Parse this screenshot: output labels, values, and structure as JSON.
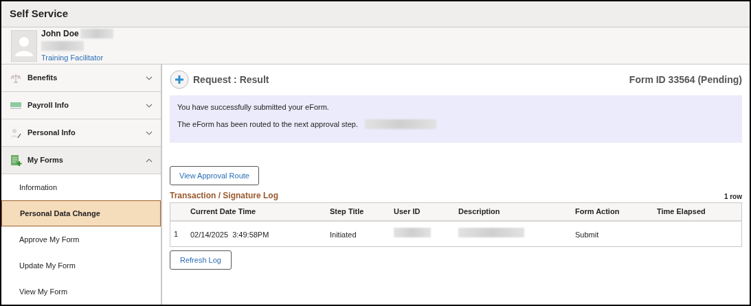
{
  "header": {
    "title": "Self Service"
  },
  "profile": {
    "name": "John Doe",
    "role": "Training Facilitator"
  },
  "sidebar": {
    "sections": [
      {
        "label": "Benefits",
        "expanded": false
      },
      {
        "label": "Payroll Info",
        "expanded": false
      },
      {
        "label": "Personal Info",
        "expanded": false
      },
      {
        "label": "My Forms",
        "expanded": true,
        "children": [
          {
            "label": "Information",
            "selected": false
          },
          {
            "label": "Personal Data Change",
            "selected": true
          },
          {
            "label": "Approve My Form",
            "selected": false
          },
          {
            "label": "Update My Form",
            "selected": false
          },
          {
            "label": "View My Form",
            "selected": false
          }
        ]
      }
    ]
  },
  "page": {
    "title": "Request : Result",
    "form_id": "Form ID 33564 (Pending)",
    "messages": [
      "You have successfully submitted your eForm.",
      "The eForm has been routed to the next approval step."
    ],
    "buttons": [
      "View Approval Route",
      "Refresh Log"
    ],
    "log": {
      "title": "Transaction / Signature Log",
      "row_count": "1 row",
      "columns": [
        "Current Date Time",
        "Step Title",
        "User ID",
        "Description",
        "Form Action",
        "Time Elapsed"
      ],
      "rows": [
        {
          "number": "1",
          "cells": [
            {
              "kind": "text",
              "text": "02/14/2025  3:49:58PM"
            },
            {
              "kind": "text",
              "text": "Initiated"
            },
            {
              "kind": "redacted"
            },
            {
              "kind": "redacted"
            },
            {
              "kind": "text",
              "text": "Submit"
            },
            {
              "kind": "empty"
            }
          ]
        }
      ]
    }
  }
}
